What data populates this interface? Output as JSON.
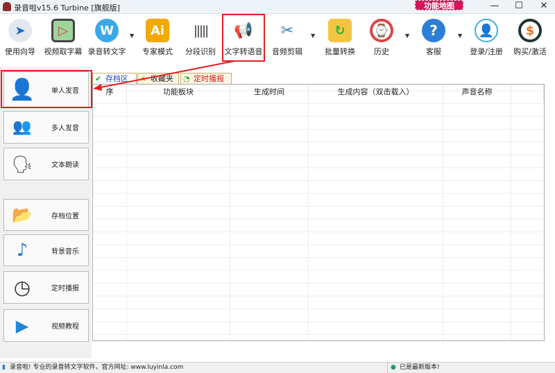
{
  "window": {
    "title": "录音啦v15.6 Turbine [旗舰版]",
    "badge": "功能地图",
    "minimize": "—",
    "maximize": "☐",
    "close": "✕"
  },
  "toolbar": [
    {
      "label": "使用向导",
      "icon": "navigate-arrow-icon"
    },
    {
      "label": "视频取字幕",
      "icon": "video-clapper-icon"
    },
    {
      "label": "录音转文字",
      "icon": "w-logo-icon"
    },
    {
      "label": "专家模式",
      "icon": "ai-icon"
    },
    {
      "label": "分段识别",
      "icon": "waveform-icon"
    },
    {
      "label": "文字转语音",
      "icon": "megaphone-icon"
    },
    {
      "label": "音频剪辑",
      "icon": "scissors-icon"
    },
    {
      "label": "批量转换",
      "icon": "folder-refresh-icon"
    },
    {
      "label": "历史",
      "icon": "history-clock-icon"
    },
    {
      "label": "客服",
      "icon": "help-icon"
    },
    {
      "label": "登录/注册",
      "icon": "user-icon"
    },
    {
      "label": "购买/激活",
      "icon": "purchase-icon"
    }
  ],
  "sidebar": [
    {
      "label": "单人发音"
    },
    {
      "label": "多人发音"
    },
    {
      "label": "文本朗读"
    },
    {
      "label": "存档位置"
    },
    {
      "label": "背景音乐"
    },
    {
      "label": "定时播报"
    },
    {
      "label": "视频教程"
    }
  ],
  "tabs": [
    {
      "label": "存档区",
      "color": "#1a3fc0"
    },
    {
      "label": "收藏夹",
      "color": "#222222"
    },
    {
      "label": "定时播报",
      "color": "#d41c1c"
    }
  ],
  "table": {
    "columns": [
      "序",
      "功能板块",
      "生成时间",
      "生成内容（双击载入）",
      "声音名称",
      ""
    ]
  },
  "status": {
    "left": "录音啦! 专业的录音转文字软件，官方网址: www.luyinla.com",
    "right": "已是最新版本!"
  }
}
